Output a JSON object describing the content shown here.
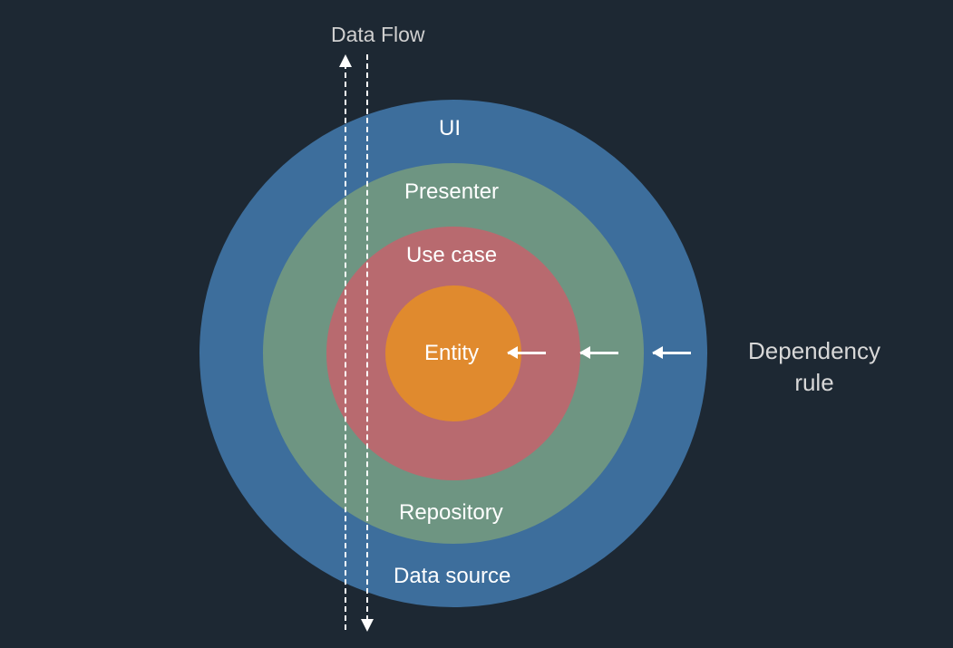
{
  "diagram": {
    "title_top": "Data Flow",
    "dependency_label_line1": "Dependency",
    "dependency_label_line2": "rule",
    "rings": {
      "outer": {
        "label_top": "UI",
        "label_bottom": "Data source",
        "color": "#3d6e9c"
      },
      "second": {
        "label_top": "Presenter",
        "label_bottom": "Repository",
        "color": "#6e9582"
      },
      "third": {
        "label_top": "Use case",
        "label_bottom": "",
        "color": "#b86a6f"
      },
      "core": {
        "label": "Entity",
        "color": "#e08a2e"
      }
    }
  }
}
